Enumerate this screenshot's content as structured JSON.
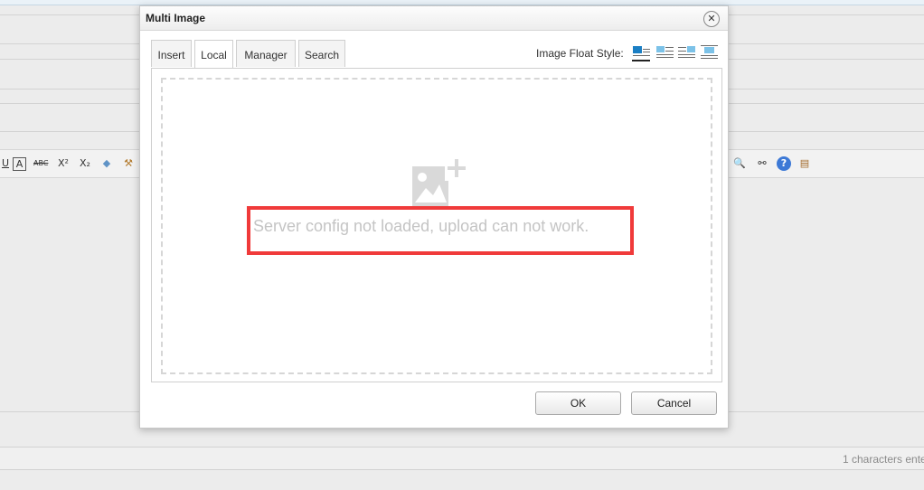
{
  "dialog": {
    "title": "Multi Image",
    "close_glyph": "✕",
    "tabs": [
      {
        "label": "Insert"
      },
      {
        "label": "Local"
      },
      {
        "label": "Manager"
      },
      {
        "label": "Search"
      }
    ],
    "active_tab": "Local",
    "float_style_label": "Image Float Style:",
    "float_options": [
      "none-float-icon",
      "left-float-icon",
      "right-float-icon",
      "center-float-icon"
    ],
    "message": "Server config not loaded, upload can not work.",
    "ok_label": "OK",
    "cancel_label": "Cancel"
  },
  "background": {
    "toolbar_icons": [
      "underline-icon",
      "font-color-icon",
      "strikethrough-icon",
      "superscript-icon",
      "subscript-icon",
      "eraser-icon",
      "format-brush-icon",
      "zoom-search-icon",
      "find-icon",
      "help-icon",
      "paste-icon"
    ],
    "status_text": "1 characters ente"
  },
  "colors": {
    "highlight_border": "#f03a3a",
    "message_text": "#c4c4c4",
    "float_icon_image": "#7cc2e8"
  }
}
